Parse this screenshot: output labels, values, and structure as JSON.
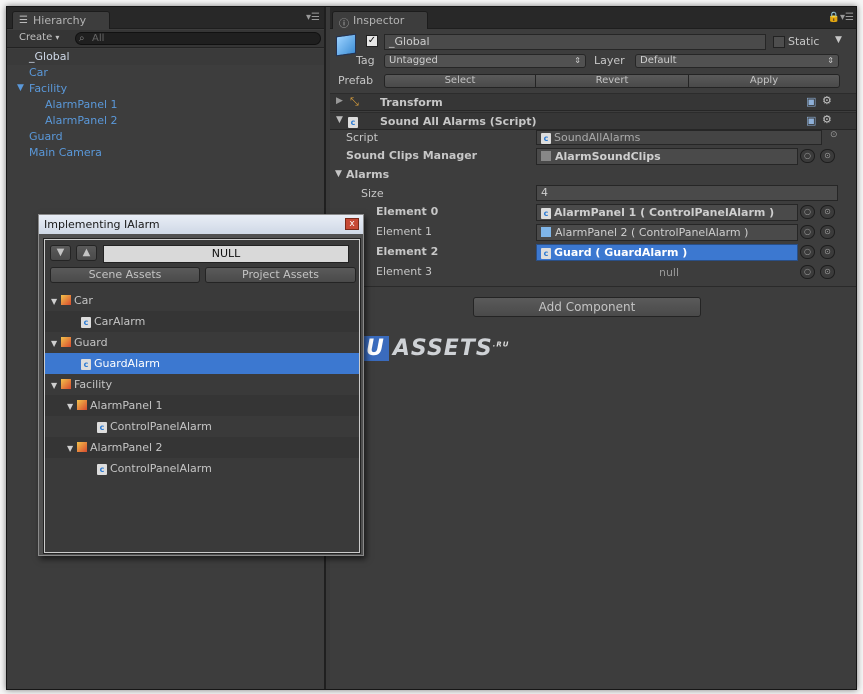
{
  "hierarchy": {
    "tab_label": "Hierarchy",
    "create_label": "Create",
    "search_placeholder": "All",
    "items": [
      {
        "label": "_Global",
        "selected": true
      },
      {
        "label": "Car"
      },
      {
        "label": "Facility",
        "expanded": true
      },
      {
        "label": "AlarmPanel 1"
      },
      {
        "label": "AlarmPanel 2"
      },
      {
        "label": "Guard"
      },
      {
        "label": "Main Camera"
      }
    ]
  },
  "inspector": {
    "tab_label": "Inspector",
    "object_name": "_Global",
    "static_label": "Static",
    "tag_label": "Tag",
    "tag_value": "Untagged",
    "layer_label": "Layer",
    "layer_value": "Default",
    "prefab_label": "Prefab",
    "prefab_buttons": [
      "Select",
      "Revert",
      "Apply"
    ],
    "transform_label": "Transform",
    "component_label": "Sound All Alarms (Script)",
    "script_label": "Script",
    "script_value": "SoundAllAlarms",
    "sound_manager_label": "Sound Clips Manager",
    "sound_manager_value": "AlarmSoundClips",
    "alarms_label": "Alarms",
    "size_label": "Size",
    "size_value": "4",
    "elements": [
      {
        "label": "Element 0",
        "value": "AlarmPanel 1 ( ControlPanelAlarm )"
      },
      {
        "label": "Element 1",
        "value": "AlarmPanel 2 ( ControlPanelAlarm )"
      },
      {
        "label": "Element 2",
        "value": "Guard ( GuardAlarm )"
      },
      {
        "label": "Element 3",
        "value": "null"
      }
    ],
    "add_component_label": "Add Component"
  },
  "popup": {
    "title": "Implementing IAlarm",
    "close_glyph": "x",
    "null_label": "NULL",
    "scene_assets_label": "Scene Assets",
    "project_assets_label": "Project Assets",
    "rows": [
      {
        "label": "Car",
        "kind": "object"
      },
      {
        "label": "CarAlarm",
        "kind": "script"
      },
      {
        "label": "Guard",
        "kind": "object"
      },
      {
        "label": "GuardAlarm",
        "kind": "script"
      },
      {
        "label": "Facility",
        "kind": "object"
      },
      {
        "label": "AlarmPanel 1",
        "kind": "object"
      },
      {
        "label": "ControlPanelAlarm",
        "kind": "script"
      },
      {
        "label": "AlarmPanel 2",
        "kind": "object"
      },
      {
        "label": "ControlPanelAlarm",
        "kind": "script"
      }
    ]
  },
  "watermark": {
    "u": "U",
    "text": "ASSETS",
    "suffix": ".RU"
  },
  "colors": {
    "selection": "#3c78d0",
    "link_text": "#5a98d9",
    "panel": "#3d3d3d"
  }
}
